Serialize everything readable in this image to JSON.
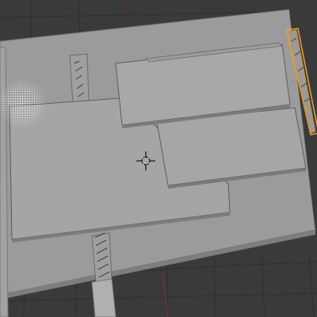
{
  "viewport": {
    "mode": "3d-viewport",
    "background_color": "#3a3a3a",
    "grid_color": "#2f2f2f",
    "axis_x_color": "#a33a4a",
    "axis_y_color": "#5a7a2a",
    "base_plate_color": "#9b9b9b",
    "panel_color": "#a3a3a3",
    "selection_outline_color": "#f0a030",
    "light_gizmo": "point-light-halo",
    "cursor": "3d-cursor-icon"
  }
}
